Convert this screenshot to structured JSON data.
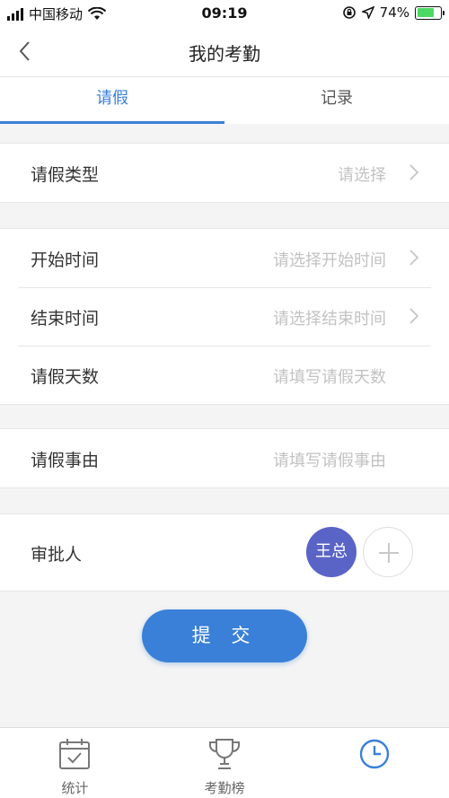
{
  "status_bar": {
    "carrier": "中国移动",
    "time": "09:19",
    "battery": "74%",
    "battery_level": 0.74,
    "icons": [
      "signal-icon",
      "wifi-icon",
      "lock-rotation-icon",
      "location-icon",
      "battery-icon"
    ]
  },
  "nav": {
    "title": "我的考勤",
    "back_icon": "chevron-left-icon"
  },
  "tabs": [
    {
      "label": "请假",
      "active": true
    },
    {
      "label": "记录",
      "active": false
    }
  ],
  "form": {
    "leave_type": {
      "label": "请假类型",
      "placeholder": "请选择"
    },
    "start_time": {
      "label": "开始时间",
      "placeholder": "请选择开始时间"
    },
    "end_time": {
      "label": "结束时间",
      "placeholder": "请选择结束时间"
    },
    "days": {
      "label": "请假天数",
      "placeholder": "请填写请假天数"
    },
    "reason": {
      "label": "请假事由",
      "placeholder": "请填写请假事由"
    },
    "approver": {
      "label": "审批人",
      "name": "王总"
    }
  },
  "submit_label": "提 交",
  "bottom_nav": [
    {
      "label": "统计",
      "icon": "calendar-check-icon"
    },
    {
      "label": "考勤榜",
      "icon": "trophy-icon"
    },
    {
      "label": "",
      "icon": "clock-icon",
      "active": true
    }
  ],
  "colors": {
    "accent": "#3a80d8",
    "avatar": "#5a63c6",
    "background": "#f4f4f4",
    "placeholder": "#c2c2c2"
  }
}
